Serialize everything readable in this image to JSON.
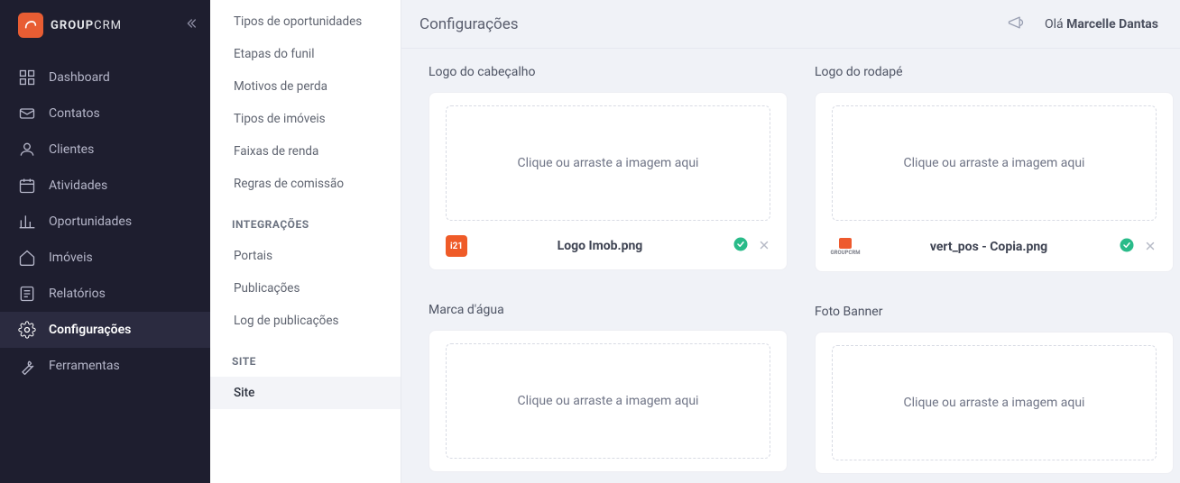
{
  "brand": {
    "badge": "CRM",
    "name_bold": "GROUP",
    "name_light": "CRM"
  },
  "header": {
    "page_title": "Configurações",
    "greeting_prefix": "Olá ",
    "user_name": "Marcelle Dantas"
  },
  "nav": [
    {
      "icon": "dashboard",
      "label": "Dashboard"
    },
    {
      "icon": "contacts",
      "label": "Contatos"
    },
    {
      "icon": "clients",
      "label": "Clientes"
    },
    {
      "icon": "calendar",
      "label": "Atividades"
    },
    {
      "icon": "opportunities",
      "label": "Oportunidades"
    },
    {
      "icon": "house",
      "label": "Imóveis"
    },
    {
      "icon": "reports",
      "label": "Relatórios"
    },
    {
      "icon": "settings",
      "label": "Configurações"
    },
    {
      "icon": "tools",
      "label": "Ferramentas"
    }
  ],
  "submenu": {
    "group1_items": [
      "Tipos de oportunidades",
      "Etapas do funil",
      "Motivos de perda",
      "Tipos de imóveis",
      "Faixas de renda",
      "Regras de comissão"
    ],
    "group2_heading": "INTEGRAÇÕES",
    "group2_items": [
      "Portais",
      "Publicações",
      "Log de publicações"
    ],
    "group3_heading": "SITE",
    "group3_items": [
      "Site"
    ]
  },
  "sections": {
    "header_logo": {
      "label": "Logo do cabeçalho",
      "dropzone_text": "Clique ou arraste a imagem aqui",
      "file_name": "Logo Imob.png",
      "thumb_text": "i21"
    },
    "footer_logo": {
      "label": "Logo do rodapé",
      "dropzone_text": "Clique ou arraste a imagem aqui",
      "file_name": "vert_pos - Copia.png",
      "thumb_mini_label": "GROUPCRM"
    },
    "watermark": {
      "label": "Marca d'água",
      "dropzone_text": "Clique ou arraste a imagem aqui"
    },
    "banner": {
      "label": "Foto Banner",
      "dropzone_text": "Clique ou arraste a imagem aqui"
    }
  }
}
